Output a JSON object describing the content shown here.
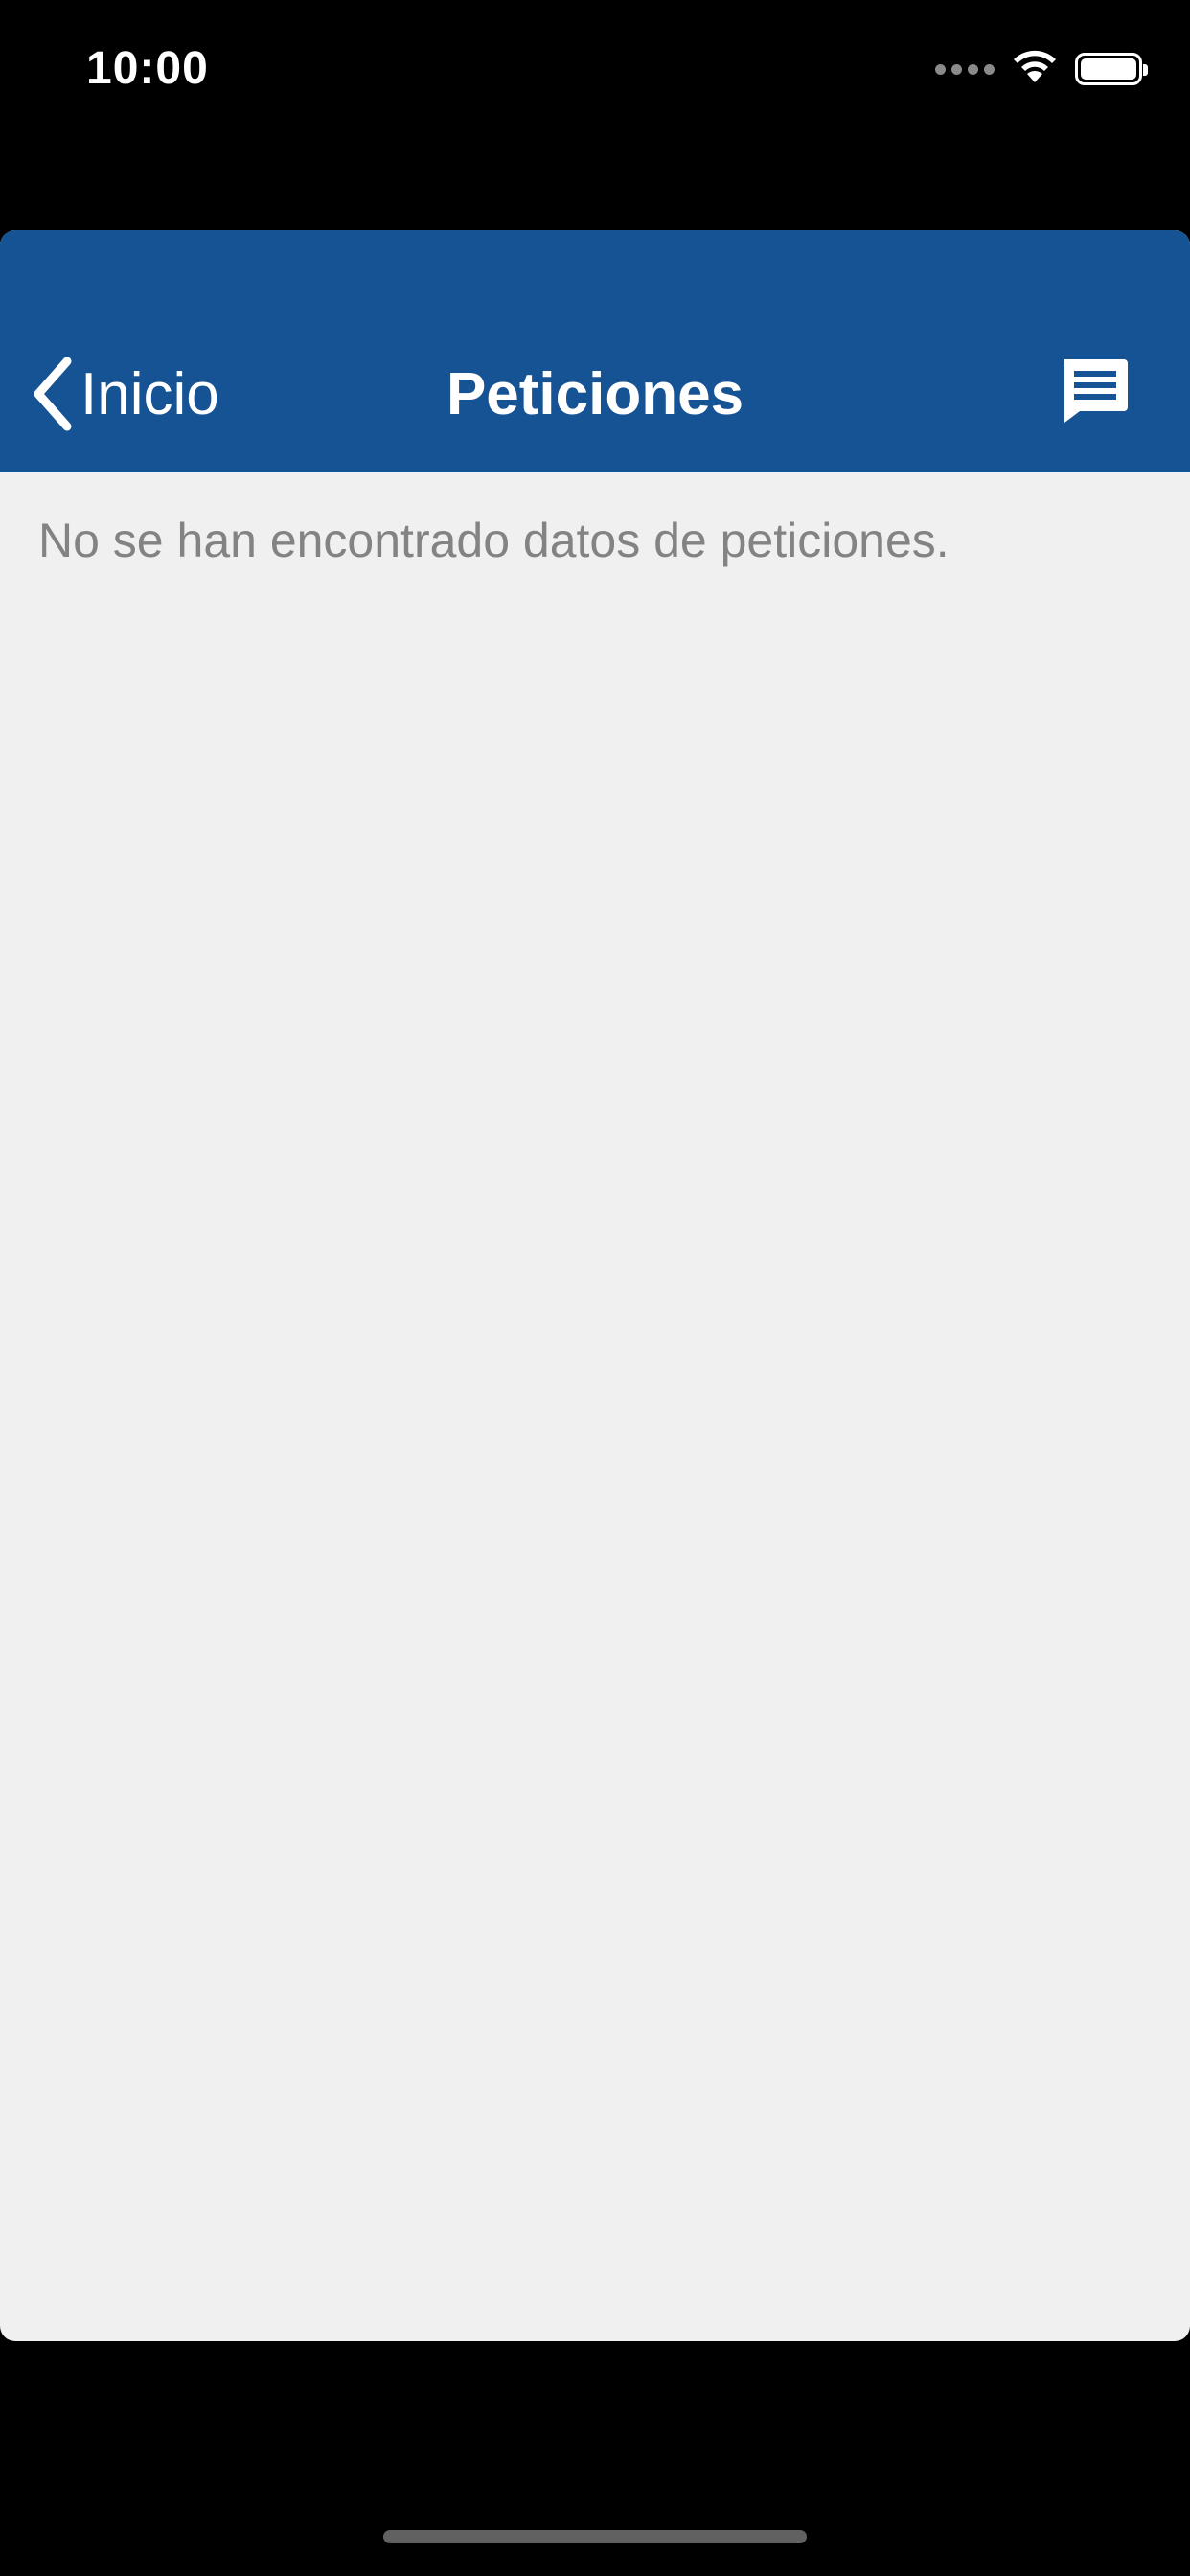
{
  "status_bar": {
    "time": "10:00",
    "icons": [
      "cellular-signal-icon",
      "wifi-icon",
      "battery-icon"
    ]
  },
  "navbar": {
    "back_label": "Inicio",
    "title": "Peticiones",
    "action_icon": "chat-icon",
    "background": "#165394"
  },
  "content": {
    "empty_message": "No se han encontrado datos de peticiones."
  }
}
